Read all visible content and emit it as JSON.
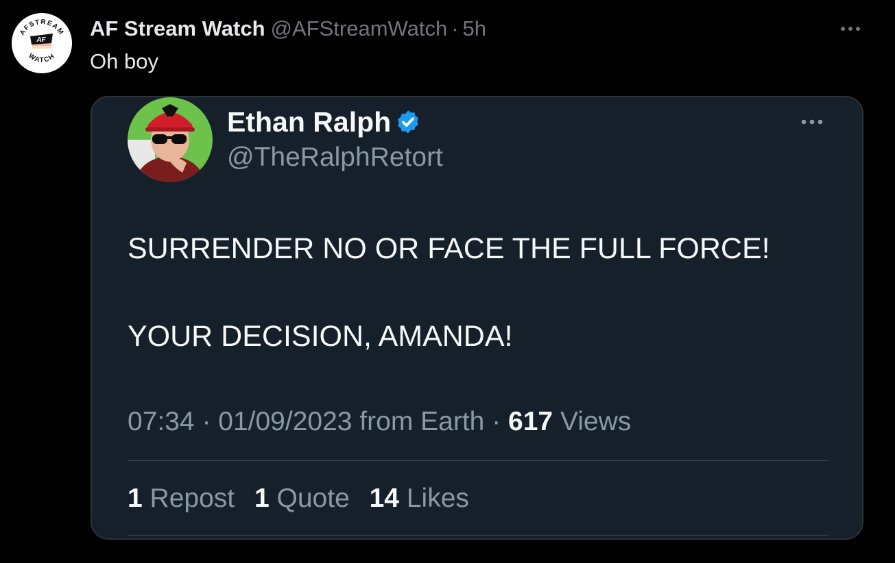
{
  "post": {
    "author": {
      "display_name": "AF Stream Watch",
      "handle": "@AFStreamWatch",
      "avatar_text_top": "AFSTREAM",
      "avatar_text_bottom": "WATCH",
      "avatar_mark": "AF"
    },
    "separator": "·",
    "timestamp": "5h",
    "text": "Oh boy",
    "more_icon": "more-horizontal-icon"
  },
  "embedded_tweet": {
    "author": {
      "display_name": "Ethan Ralph",
      "handle": "@TheRalphRetort",
      "verified_icon": "verified-badge-icon"
    },
    "lines": [
      "SURRENDER NO OR FACE THE FULL FORCE!",
      "YOUR DECISION, AMANDA!"
    ],
    "meta": {
      "time": "07:34",
      "sep1": " · ",
      "date": "01/09/2023 from Earth",
      "sep2": " · ",
      "views_count": "617",
      "views_label": " Views"
    },
    "stats": {
      "reposts_count": "1",
      "reposts_label": "Repost",
      "quotes_count": "1",
      "quotes_label": "Quote",
      "likes_count": "14",
      "likes_label": "Likes"
    }
  },
  "colors": {
    "background": "#000000",
    "card_background": "#15202b",
    "primary_text": "#e7e9ea",
    "secondary_text": "#71767b",
    "verified_blue": "#1d9bf0"
  }
}
